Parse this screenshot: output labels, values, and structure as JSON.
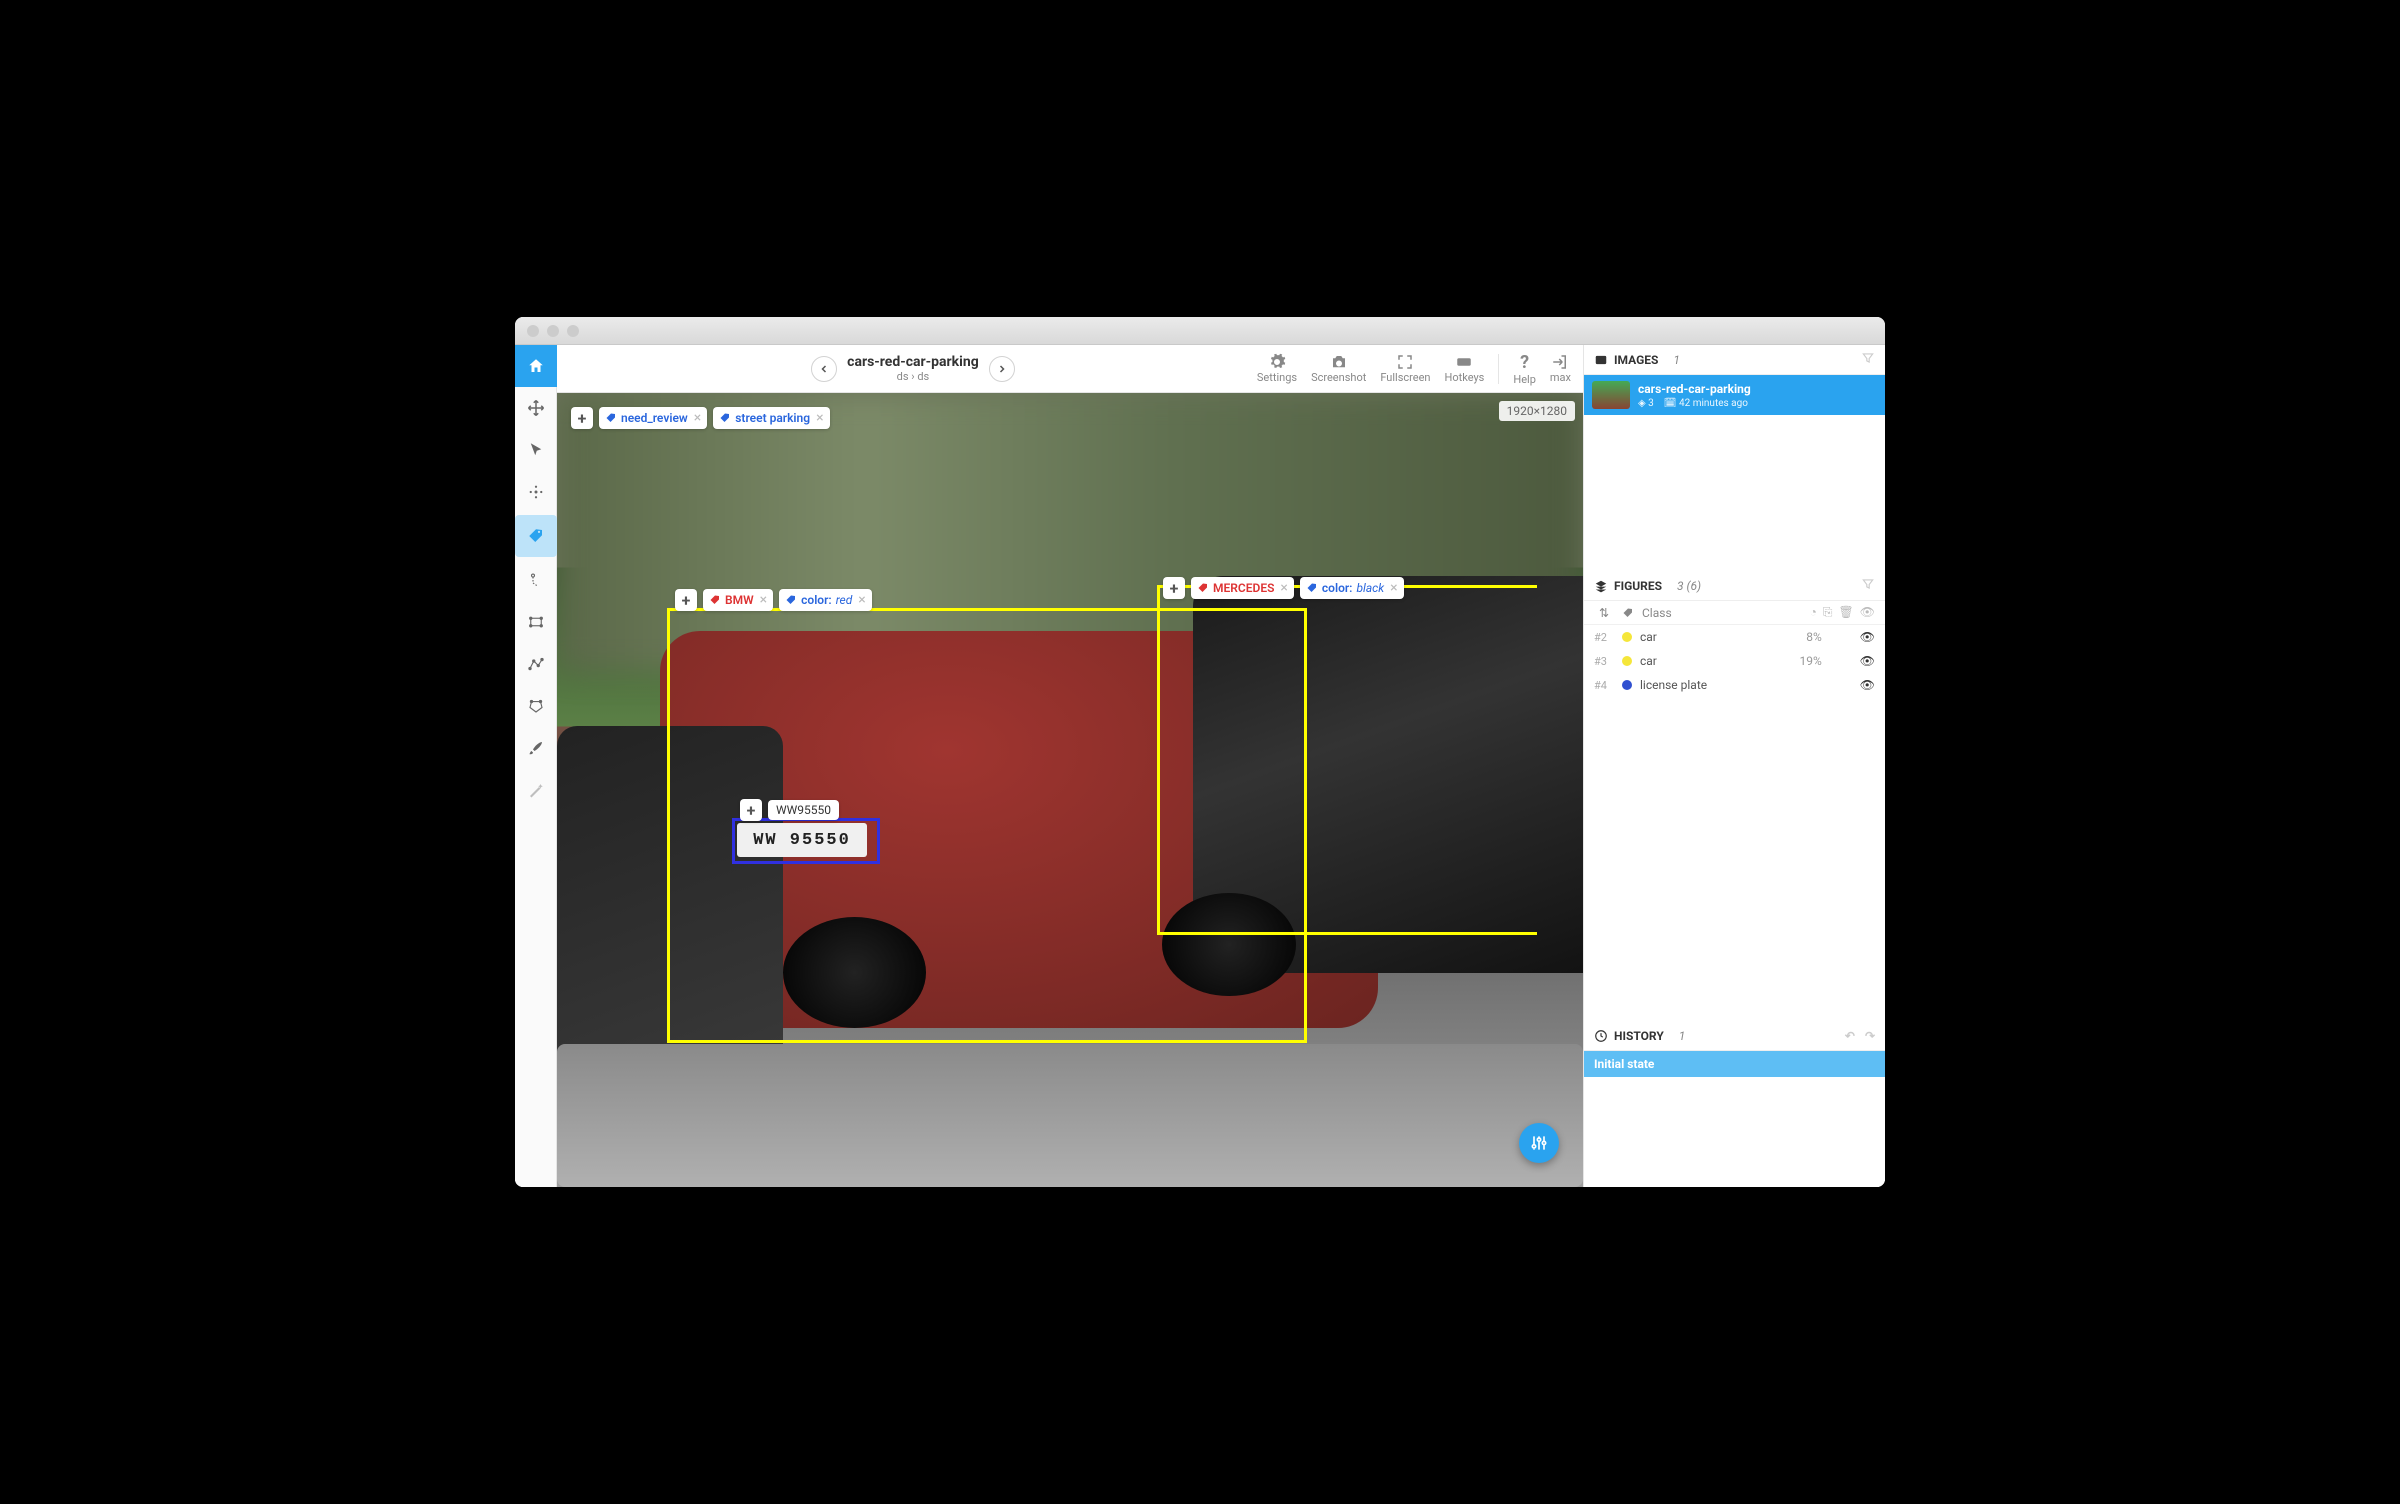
{
  "header": {
    "title": "cars-red-car-parking",
    "crumb1": "ds",
    "crumb2": "ds",
    "actions": {
      "settings": "Settings",
      "screenshot": "Screenshot",
      "fullscreen": "Fullscreen",
      "hotkeys": "Hotkeys",
      "help": "Help",
      "user": "max"
    }
  },
  "canvas": {
    "dimensions": "1920×1280",
    "top_tags": {
      "t0": "need_review",
      "t1": "street parking"
    },
    "bbox1": {
      "tag_brand": "BMW",
      "tag_attr_key": "color:",
      "tag_attr_val": "red"
    },
    "bbox2": {
      "tag_brand": "MERCEDES",
      "tag_attr_key": "color:",
      "tag_attr_val": "black"
    },
    "plate": {
      "label": "WW95550",
      "drawn": "WW 95550"
    }
  },
  "images_panel": {
    "title": "IMAGES",
    "count": "1",
    "item": {
      "name": "cars-red-car-parking",
      "layers": "3",
      "time": "42 minutes ago"
    }
  },
  "figures_panel": {
    "title": "FIGURES",
    "count": "3 (6)",
    "class_label": "Class",
    "rows": [
      {
        "idx": "#2",
        "color": "y",
        "name": "car",
        "pct": "8%"
      },
      {
        "idx": "#3",
        "color": "y",
        "name": "car",
        "pct": "19%"
      },
      {
        "idx": "#4",
        "color": "b",
        "name": "license plate",
        "pct": ""
      }
    ]
  },
  "history_panel": {
    "title": "HISTORY",
    "count": "1",
    "item": "Initial state"
  }
}
